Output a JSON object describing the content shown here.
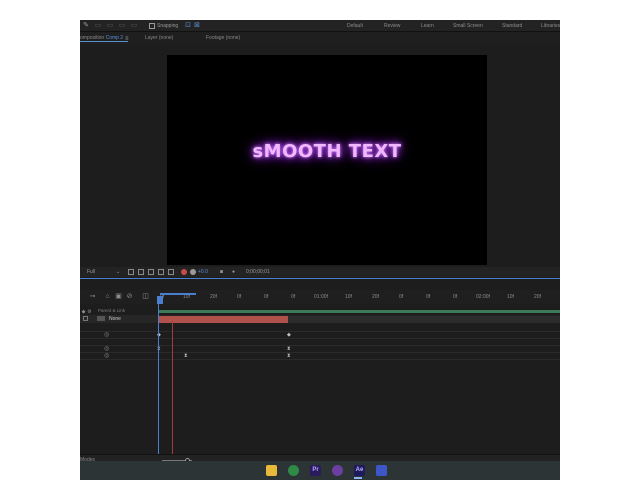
{
  "toolbar": {
    "snapping_label": "Snapping",
    "workspaces": [
      "Default",
      "Review",
      "Learn",
      "Small Screen",
      "Standard",
      "Libraries"
    ]
  },
  "panel_tabs": {
    "composition_prefix": "omposition",
    "composition_name": "Comp 2",
    "menu_icon": "≡",
    "layer_tab": "Layer (none)",
    "footage_tab": "Footage (none)"
  },
  "viewer": {
    "text": "sMOOTH TEXT",
    "text_color": "#f0b8ff",
    "glow_color": "#b640ff"
  },
  "viewer_bar": {
    "resolution": "Full",
    "exposure": "+0.0",
    "timecode": "0;00;00;01"
  },
  "timeline": {
    "ruler_ticks": [
      "0f",
      "10f",
      "20f",
      "0f",
      "0f",
      "0f",
      "01:00f",
      "10f",
      "20f",
      "0f",
      "0f",
      "0f",
      "02:00f",
      "10f",
      "20f"
    ],
    "column_header": "Parent & Link",
    "layer_parent": "None",
    "modes_label": "Modes"
  },
  "colors": {
    "accent": "#4a7fd0",
    "layer_bar": "#b0514c",
    "work_area_bar": "#3e7a59"
  }
}
